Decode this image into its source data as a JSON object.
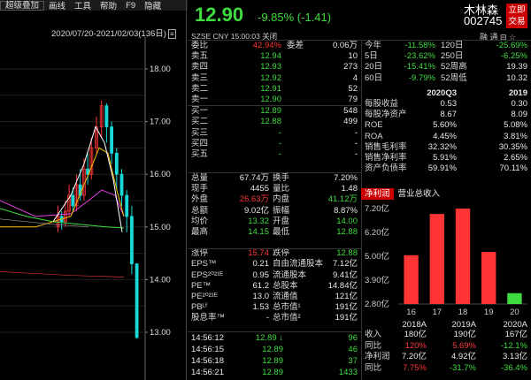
{
  "menu": [
    "超级叠加",
    "画线",
    "工具",
    "帮助",
    "F9",
    "隐藏"
  ],
  "chart": {
    "range_label": "2020/07/20-2021/02/03(136日)",
    "range_box": "≡",
    "price_ticks": [
      "18.00",
      "17.00",
      "16.00",
      "15.00",
      "14.00",
      "13.00"
    ],
    "colors": {
      "up": "#ff3535",
      "down": "#19d8d8",
      "ma5": "#ffffff",
      "ma10": "#f0c000",
      "ma20": "#e040e0",
      "ma60": "#3fdc3f"
    }
  },
  "header": {
    "price": "12.90",
    "change": "-9.85% (-1.41)",
    "name": "木林森",
    "code": "002745",
    "trade_button": [
      "立即",
      "交易"
    ]
  },
  "info": {
    "line": "SZSE  CNY  15:00:03  关闭",
    "icons": "融 通 ⊟ ☆"
  },
  "book": {
    "top": [
      {
        "label": "委比",
        "value": "42.94%",
        "label2": "委差",
        "value2": "0.06万"
      }
    ],
    "asks": [
      {
        "label": "卖五",
        "price": "12.94",
        "vol": "10"
      },
      {
        "label": "卖四",
        "price": "12.93",
        "vol": "273"
      },
      {
        "label": "卖三",
        "price": "12.92",
        "vol": "4"
      },
      {
        "label": "卖二",
        "price": "12.91",
        "vol": "52"
      },
      {
        "label": "卖一",
        "price": "12.90",
        "vol": "79"
      }
    ],
    "bids": [
      {
        "label": "买一",
        "price": "12.89",
        "vol": "548"
      },
      {
        "label": "买二",
        "price": "12.88",
        "vol": "499"
      },
      {
        "label": "买三",
        "price": "-",
        "vol": "-"
      },
      {
        "label": "买四",
        "price": "-",
        "vol": "-"
      },
      {
        "label": "买五",
        "price": "-",
        "vol": "-"
      }
    ]
  },
  "stats": [
    {
      "l1": "总量",
      "v1": "67.74万",
      "l2": "换手",
      "v2": "7.20%",
      "c1": "wht",
      "c2": "wht"
    },
    {
      "l1": "现手",
      "v1": "4455",
      "l2": "量比",
      "v2": "1.48",
      "c1": "wht",
      "c2": "wht"
    },
    {
      "l1": "外盘",
      "v1": "26.63万",
      "l2": "内盘",
      "v2": "41.12万",
      "c1": "red",
      "c2": "grn"
    },
    {
      "l1": "总额",
      "v1": "9.02亿",
      "l2": "振幅",
      "v2": "8.87%",
      "c1": "wht",
      "c2": "wht"
    },
    {
      "l1": "均价",
      "v1": "13.32",
      "l2": "开盘",
      "v2": "14.00",
      "c1": "grn",
      "c2": "grn"
    },
    {
      "l1": "最高",
      "v1": "14.15",
      "l2": "最低",
      "v2": "12.88",
      "c1": "grn",
      "c2": "grn"
    },
    {
      "l1": "涨停",
      "v1": "15.74",
      "l2": "跌停",
      "v2": "12.88",
      "c1": "red",
      "c2": "grn"
    },
    {
      "l1": "EPS™",
      "v1": "0.21",
      "l2": "自由流通股本",
      "v2": "7.12亿",
      "c1": "wht",
      "c2": "wht"
    },
    {
      "l1": "EPS²⁰²¹ᴱ",
      "v1": "0.95",
      "l2": "流通股本",
      "v2": "9.41亿",
      "c1": "wht",
      "c2": "wht"
    },
    {
      "l1": "PE™",
      "v1": "61.2",
      "l2": "总股本",
      "v2": "14.84亿",
      "c1": "wht",
      "c2": "wht"
    },
    {
      "l1": "PE²⁰²¹ᴱ",
      "v1": "13.0",
      "l2": "流通值",
      "v2": "121亿",
      "c1": "wht",
      "c2": "wht"
    },
    {
      "l1": "PBᴸᶠ",
      "v1": "1.53",
      "l2": "总市值¹",
      "v2": "191亿",
      "c1": "wht",
      "c2": "wht"
    },
    {
      "l1": "股息率™",
      "v1": "-",
      "l2": "总市值²",
      "v2": "191亿",
      "c1": "wht",
      "c2": "wht"
    }
  ],
  "ticks": [
    {
      "time": "14:56:12",
      "price": "12.89 ↓",
      "vol": "96"
    },
    {
      "time": "14:56:15",
      "price": "12.89",
      "vol": "46"
    },
    {
      "time": "14:56:18",
      "price": "12.89",
      "vol": "37"
    },
    {
      "time": "14:56:21",
      "price": "12.89",
      "vol": "1433"
    }
  ],
  "periods": [
    {
      "l1": "今年",
      "v1": "-11.58%",
      "l2": "120日",
      "v2": "-25.69%"
    },
    {
      "l1": "5日",
      "v1": "-23.62%",
      "l2": "250日",
      "v2": "-6.25%"
    },
    {
      "l1": "20日",
      "v1": "-15.41%",
      "l2": "52周高",
      "v2": "19.39"
    },
    {
      "l1": "60日",
      "v1": "-9.79%",
      "l2": "52周低",
      "v2": "10.32"
    }
  ],
  "fin_head": [
    "2020Q3",
    "2019"
  ],
  "fin": [
    {
      "l": "每股收益",
      "a": "0.53",
      "b": "0.30",
      "ca": "wht",
      "cb": "wht"
    },
    {
      "l": "每股净资产",
      "a": "8.67",
      "b": "8.09",
      "ca": "wht",
      "cb": "wht"
    },
    {
      "l": "ROE",
      "a": "5.60%",
      "b": "5.08%",
      "ca": "wht",
      "cb": "wht"
    },
    {
      "l": "ROA",
      "a": "4.45%",
      "b": "3.81%",
      "ca": "wht",
      "cb": "wht"
    },
    {
      "l": "销售毛利率",
      "a": "32.32%",
      "b": "30.35%",
      "ca": "wht",
      "cb": "wht"
    },
    {
      "l": "销售净利率",
      "a": "5.91%",
      "b": "2.65%",
      "ca": "wht",
      "cb": "wht"
    },
    {
      "l": "资产负债率",
      "a": "59.91%",
      "b": "70.11%",
      "ca": "wht",
      "cb": "wht"
    }
  ],
  "tabs": {
    "profit": "净利润",
    "revenue": "营业总收入"
  },
  "chart_data": {
    "type": "bar",
    "categories": [
      "16",
      "17",
      "18",
      "19",
      "20"
    ],
    "values": [
      5.05,
      6.95,
      7.2,
      5.2,
      3.3
    ],
    "colors": [
      "#ff3535",
      "#ff3535",
      "#ff3535",
      "#ff3535",
      "#3fdc3f"
    ],
    "yticks": [
      "7.20亿",
      "6.20亿",
      "5.00亿",
      "3.90亿",
      "2.80亿"
    ],
    "ylim": [
      2.8,
      7.2
    ]
  },
  "fin2_head": [
    "2018A",
    "2019A",
    "2020A"
  ],
  "fin2": [
    {
      "l": "收入",
      "a": "180亿",
      "b": "190亿",
      "c": "167亿",
      "ca": "wht",
      "cb": "wht",
      "cc": "wht"
    },
    {
      "l": "同比",
      "a": "120%",
      "b": "5.69%",
      "c": "-12.1%",
      "ca": "red",
      "cb": "red",
      "cc": "grn"
    },
    {
      "l": "净利润",
      "a": "7.20亿",
      "b": "4.92亿",
      "c": "3.13亿",
      "ca": "wht",
      "cb": "wht",
      "cc": "wht"
    },
    {
      "l": "同比",
      "a": "7.75%",
      "b": "-31.7%",
      "c": "-36.4%",
      "ca": "red",
      "cb": "grn",
      "cc": "grn"
    }
  ]
}
